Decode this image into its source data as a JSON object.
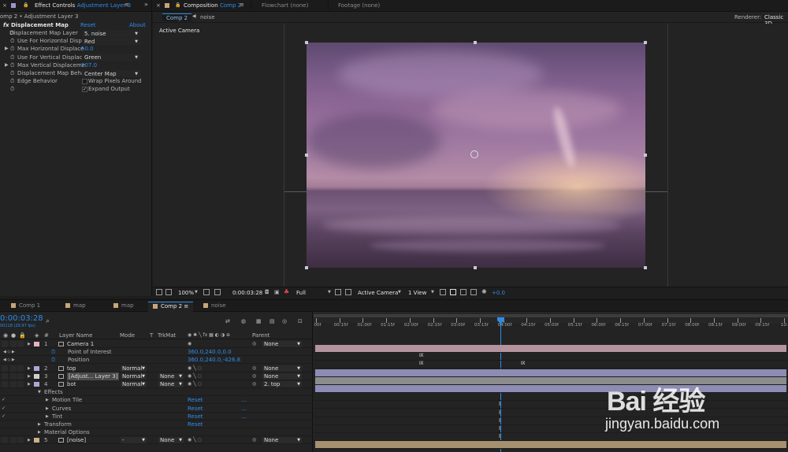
{
  "effect_controls": {
    "tab_label": "Effect Controls",
    "tab_target": "Adjustment Layer 3",
    "breadcrumb": "omp 2 • Adjustment Layer 3",
    "effect_name": "Displacement Map",
    "reset": "Reset",
    "about": "About",
    "props": [
      {
        "label": "Displacement Map Layer",
        "value": "5. noise",
        "kind": "dropdown"
      },
      {
        "label": "Use For Horizontal Displ",
        "value": "Red",
        "kind": "dropdown"
      },
      {
        "label": "Max Horizontal Displace",
        "value": "50.0",
        "kind": "number"
      },
      {
        "label": "Use For Vertical Displace",
        "value": "Green",
        "kind": "dropdown"
      },
      {
        "label": "Max Vertical Displaceme",
        "value": "107.0",
        "kind": "number"
      },
      {
        "label": "Displacement Map Behav",
        "value": "Center Map",
        "kind": "dropdown"
      },
      {
        "label": "Edge Behavior",
        "value": "Wrap Pixels Around",
        "kind": "checkbox",
        "checked": false
      },
      {
        "label": "",
        "value": "Expand Output",
        "kind": "checkbox",
        "checked": true
      }
    ]
  },
  "composition": {
    "tab_label": "Composition",
    "tab_target": "Comp 2",
    "flowchart_tab": "Flowchart (none)",
    "footage_tab": "Footage (none)",
    "sub_tabs": [
      "Comp 2",
      "noise"
    ],
    "renderer_label": "Renderer:",
    "renderer_value": "Classic 3D",
    "view_label": "Active Camera",
    "footer": {
      "zoom": "100%",
      "timecode": "0:00:03:28",
      "resolution": "Full",
      "camera": "Active Camera",
      "views": "1 View",
      "exposure": "+0.0"
    }
  },
  "timeline": {
    "tabs": [
      "Comp 1",
      "map",
      "map",
      "Comp 2",
      "noise"
    ],
    "active_tab": "Comp 2",
    "timecode": "0:00:03:28",
    "fps": "00118 (29.97 fps)",
    "search_icon": "search-icon",
    "columns": {
      "hash": "#",
      "layer_name": "Layer Name",
      "mode": "Mode",
      "t": "T",
      "trkmat": "TrkMat",
      "parent": "Parent"
    },
    "layers": [
      {
        "num": "1",
        "name": "Camera 1",
        "color": "#e6b3c2",
        "parent": "None"
      },
      {
        "sub": "Point of Interest",
        "value": "360.0,240.0,0.0"
      },
      {
        "sub": "Position",
        "value": "360.0,240.0,-426.8"
      },
      {
        "num": "2",
        "name": "top",
        "color": "#a9a8d8",
        "mode": "Normal",
        "parent": "None"
      },
      {
        "num": "3",
        "name": "[Adjust... Layer 3]",
        "color": "#cfcfcf",
        "mode": "Normal",
        "trkmat": "None",
        "parent": "None"
      },
      {
        "num": "4",
        "name": "bot",
        "color": "#a9a8d8",
        "mode": "Normal",
        "trkmat": "None",
        "parent": "2. top"
      },
      {
        "group": "Effects"
      },
      {
        "effect": "Motion Tile",
        "reset": "Reset",
        "dots": "..."
      },
      {
        "effect": "Curves",
        "reset": "Reset",
        "dots": "..."
      },
      {
        "effect": "Tint",
        "reset": "Reset",
        "dots": "..."
      },
      {
        "group": "Transform",
        "reset": "Reset"
      },
      {
        "group": "Material Options"
      },
      {
        "num": "5",
        "name": "[noise]",
        "color": "#c9b28a",
        "mode": "-",
        "trkmat": "None",
        "parent": "None"
      }
    ],
    "ruler": [
      "00f",
      "00:15f",
      "01:00f",
      "01:15f",
      "02:00f",
      "02:15f",
      "03:00f",
      "03:15f",
      "04:00f",
      "04:15f",
      "05:00f",
      "05:15f",
      "06:00f",
      "06:15f",
      "07:00f",
      "07:15f",
      "08:00f",
      "08:15f",
      "09:00f",
      "09:15f",
      "10:0"
    ]
  },
  "watermark": {
    "text": "Bai 经验",
    "url": "jingyan.baidu.com"
  },
  "colors": {
    "accent": "#2d8ceb",
    "bg": "#232323"
  }
}
